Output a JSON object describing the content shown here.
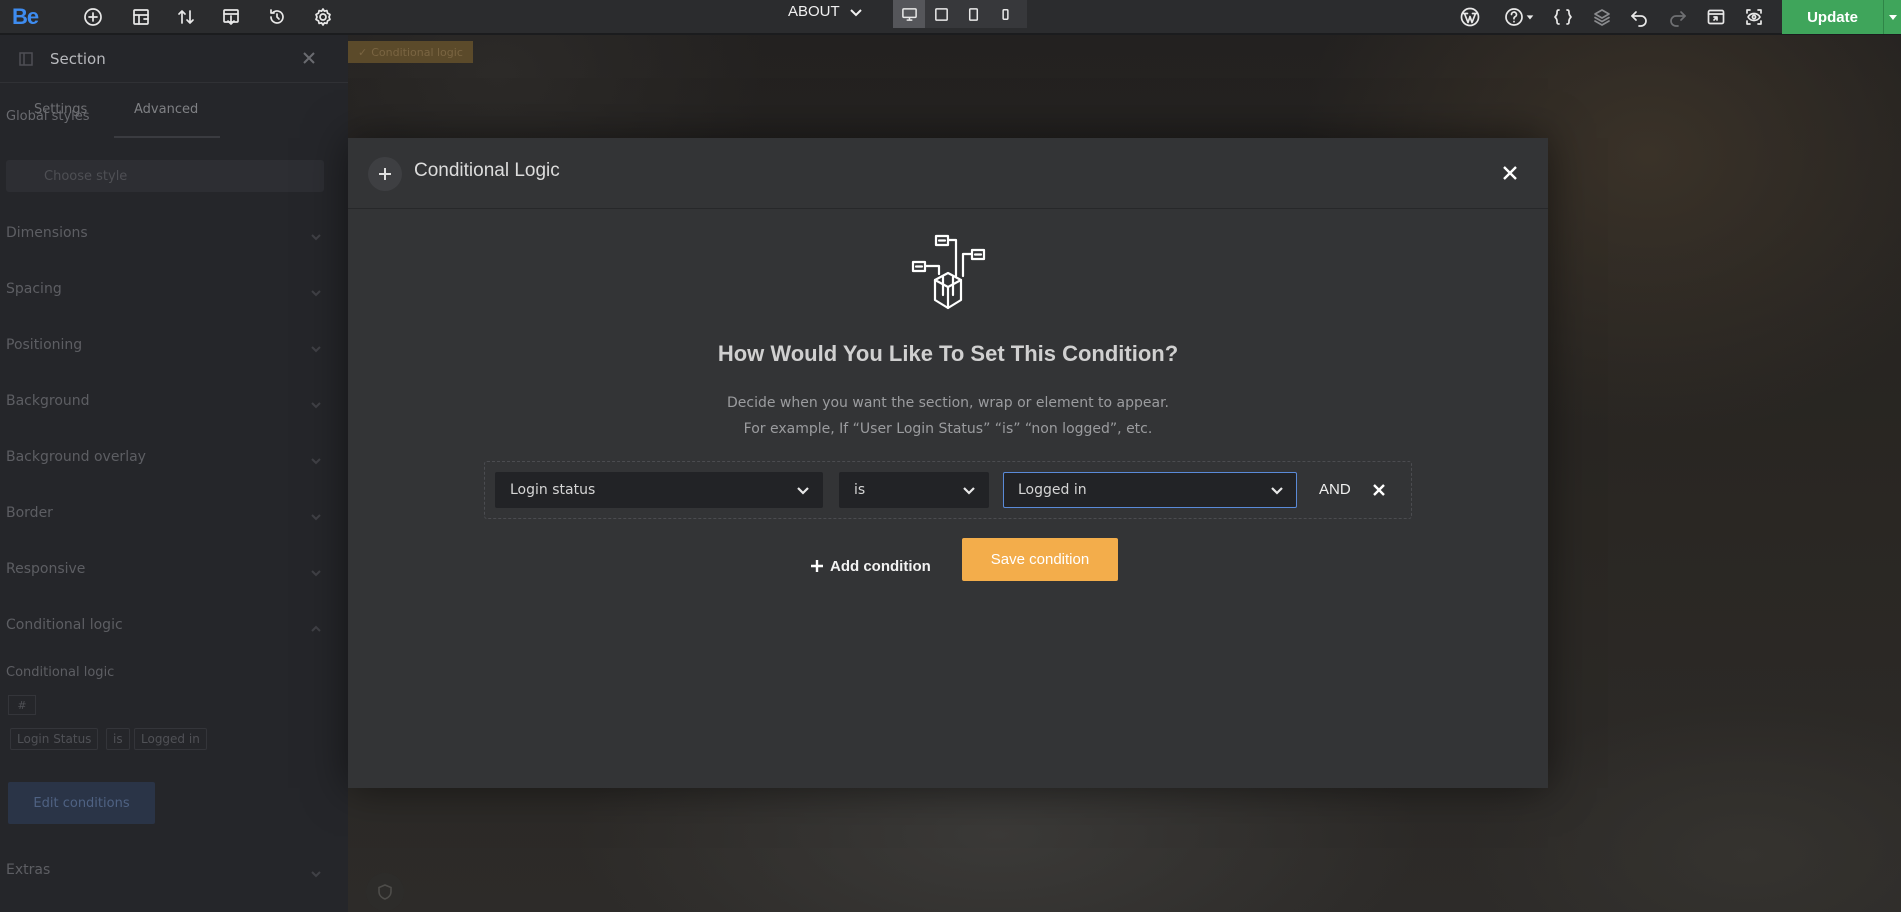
{
  "app": {
    "logo": "Be"
  },
  "toolbar": {
    "left_icons": [
      "add-element-icon",
      "layout-grid-icon",
      "sort-icon",
      "import-icon",
      "revisions-icon",
      "settings-gear-icon"
    ],
    "page_name": "ABOUT",
    "devices": [
      "desktop",
      "tablet-landscape",
      "tablet-portrait",
      "mobile"
    ],
    "active_device": "desktop",
    "right_icons": [
      "wordpress-icon",
      "help-icon",
      "css-icon",
      "layers-icon",
      "undo-icon",
      "redo-icon",
      "preview-icon",
      "view-icon"
    ],
    "update_label": "Update",
    "update_color": "#3fa55b"
  },
  "sidebar": {
    "title": "Section",
    "tabs": [
      "Settings",
      "Advanced"
    ],
    "active_tab": "Advanced",
    "global_styles_label": "Global styles",
    "global_styles_placeholder": "Choose style",
    "sections": [
      "Dimensions",
      "Spacing",
      "Positioning",
      "Background",
      "Background overlay",
      "Border",
      "Responsive",
      "Conditional logic"
    ],
    "conditional_logic_label": "Conditional logic",
    "conditional_hash": "#",
    "conditional_summary": [
      "Login Status",
      "is",
      "Logged in"
    ],
    "edit_conditions_label": "Edit conditions",
    "extras_label": "Extras"
  },
  "canvas": {
    "tag_label": "Conditional logic"
  },
  "modal": {
    "title": "Conditional Logic",
    "heading": "How Would You Like To Set This Condition?",
    "description_line1": "Decide when you want the section, wrap or element to appear.",
    "description_line2": "For example, If “User Login Status” “is” “non logged”, etc.",
    "condition": {
      "field": "Login status",
      "operator": "is",
      "value": "Logged in",
      "join_label": "AND"
    },
    "add_condition_label": "Add condition",
    "save_condition_label": "Save condition",
    "save_color": "#f3ad4b"
  }
}
